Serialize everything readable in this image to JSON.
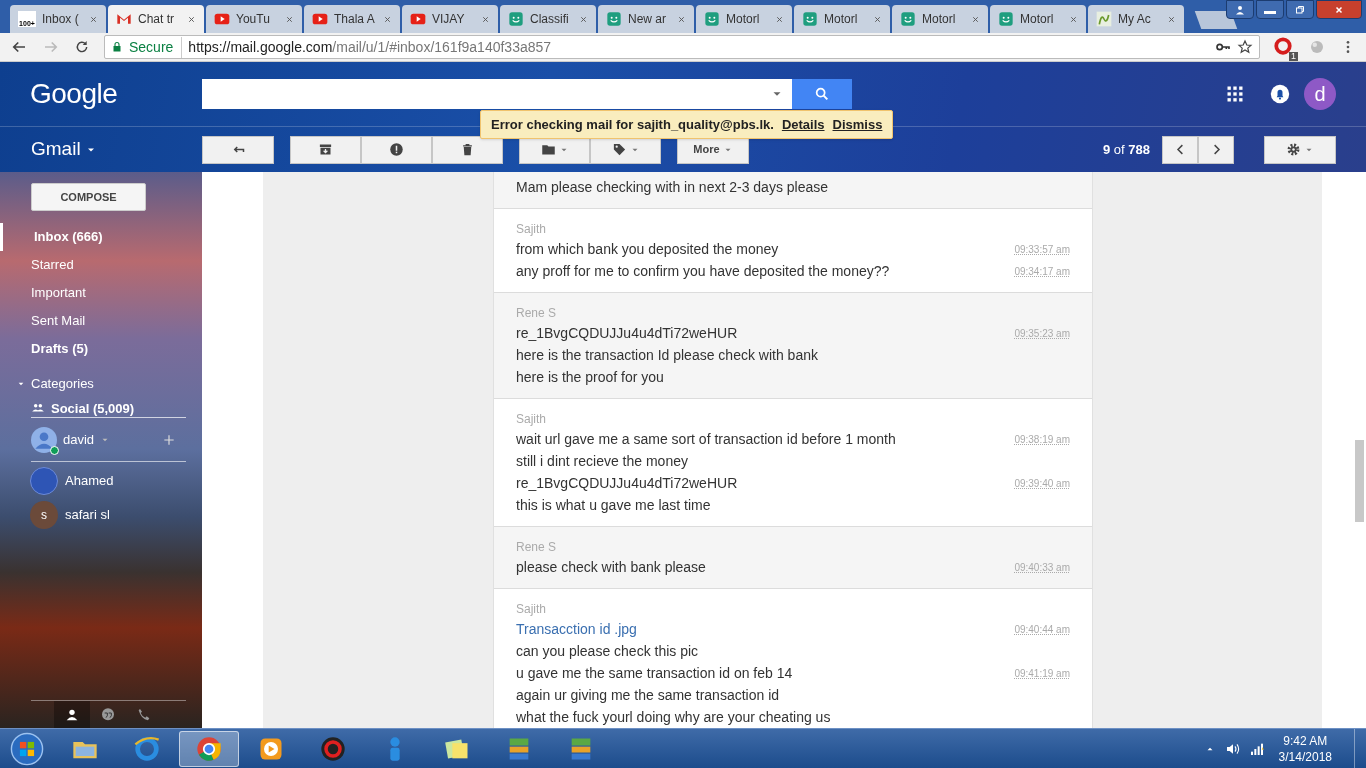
{
  "browser": {
    "tabs": [
      {
        "title": "Inbox (",
        "kind": "badge",
        "icon_text": "100+",
        "selected": false
      },
      {
        "title": "Chat tr",
        "kind": "envelope",
        "selected": true
      },
      {
        "title": "YouTu",
        "kind": "video",
        "selected": false
      },
      {
        "title": "Thala A",
        "kind": "video",
        "selected": false
      },
      {
        "title": "VIJAY",
        "kind": "video",
        "selected": false
      },
      {
        "title": "Classifi",
        "kind": "smiley",
        "selected": false
      },
      {
        "title": "New ar",
        "kind": "smiley",
        "selected": false
      },
      {
        "title": "Motorl",
        "kind": "smiley",
        "selected": false
      },
      {
        "title": "Motorl",
        "kind": "smiley",
        "selected": false
      },
      {
        "title": "Motorl",
        "kind": "smiley",
        "selected": false
      },
      {
        "title": "Motorl",
        "kind": "smiley",
        "selected": false
      },
      {
        "title": "My Ac",
        "kind": "leaf",
        "selected": false
      }
    ],
    "secure_label": "Secure",
    "url_host": "https://mail.google.com",
    "url_path": "/mail/u/1/#inbox/161f9a140f33a857",
    "extension_badge": "1"
  },
  "gmail": {
    "logo": "Google",
    "app_label": "Gmail",
    "avatar_initial": "d",
    "notice": {
      "text": "Error checking mail for sajith_quality@pbs.lk.",
      "links": [
        "Details",
        "Dismiss"
      ]
    },
    "more_label": "More",
    "page_count": "**9** of **788**",
    "compose": "COMPOSE",
    "nav": [
      {
        "label": "Inbox (666)",
        "bold": true,
        "selected": true
      },
      {
        "label": "Starred",
        "bold": false,
        "selected": false
      },
      {
        "label": "Important",
        "bold": false,
        "selected": false
      },
      {
        "label": "Sent Mail",
        "bold": false,
        "selected": false
      },
      {
        "label": "Drafts (5)",
        "bold": true,
        "selected": false
      }
    ],
    "categories": {
      "label": "Categories",
      "expanded": true,
      "items": [
        {
          "label": "Social (5,009)",
          "bold": true
        }
      ]
    },
    "hangouts": {
      "self": {
        "name": "david"
      },
      "contacts": [
        {
          "name": "Ahamed",
          "kind": "photo"
        },
        {
          "name": "safari sl",
          "kind": "initial",
          "initial": "s"
        }
      ],
      "tabs": [
        {
          "kind": "person",
          "selected": true
        },
        {
          "kind": "quote",
          "selected": false
        },
        {
          "kind": "phone",
          "selected": false
        }
      ]
    },
    "messages": [
      {
        "kind": "incoming",
        "lines": [
          {
            "text": "Mam please checking with in next 2-3 days please"
          }
        ]
      },
      {
        "kind": "outgoing",
        "sender": "Sajith",
        "lines": [
          {
            "text": "from which bank you deposited the money",
            "time": "09:33:57 am"
          },
          {
            "text": "any proff for me to confirm you have deposited the money??",
            "time": "09:34:17 am"
          }
        ]
      },
      {
        "kind": "incoming",
        "sender": "Rene S",
        "lines": [
          {
            "text": "re_1BvgCQDUJJu4u4dTi72weHUR",
            "time": "09:35:23 am"
          },
          {
            "text": "here is the transaction Id please check with bank"
          },
          {
            "text": "here is the proof for you"
          }
        ]
      },
      {
        "kind": "outgoing",
        "sender": "Sajith",
        "lines": [
          {
            "text": "wait url gave me a same sort of transaction id before 1 month",
            "time": "09:38:19 am"
          },
          {
            "text": "still i dint recieve the money"
          },
          {
            "text": "re_1BvgCQDUJJu4u4dTi72weHUR",
            "time": "09:39:40 am"
          },
          {
            "text": "this is what u gave me last time"
          }
        ]
      },
      {
        "kind": "incoming",
        "sender": "Rene S",
        "lines": [
          {
            "text": "please check with bank please",
            "time": "09:40:33 am"
          }
        ]
      },
      {
        "kind": "outgoing",
        "sender": "Sajith",
        "lines": [
          {
            "text": "Transacction id .jpg",
            "time": "09:40:44 am",
            "link": true
          },
          {
            "text": "can you please check this pic"
          },
          {
            "text": "u gave me the same transaction id on feb 14",
            "time": "09:41:19 am"
          },
          {
            "text": "again ur giving me the same transaction id"
          },
          {
            "text": "what the fuck yourl doing why are your cheating us"
          }
        ]
      }
    ]
  },
  "taskbar": {
    "apps": [
      {
        "kind": "folder",
        "selected": false
      },
      {
        "kind": "globe",
        "selected": false
      },
      {
        "kind": "browser",
        "selected": true
      },
      {
        "kind": "media",
        "selected": false
      },
      {
        "kind": "ring",
        "selected": false
      },
      {
        "kind": "person",
        "selected": false
      },
      {
        "kind": "notes",
        "selected": false
      },
      {
        "kind": "database",
        "selected": false
      },
      {
        "kind": "database",
        "selected": false
      }
    ],
    "time": "9:42 AM",
    "date": "3/14/2018"
  }
}
